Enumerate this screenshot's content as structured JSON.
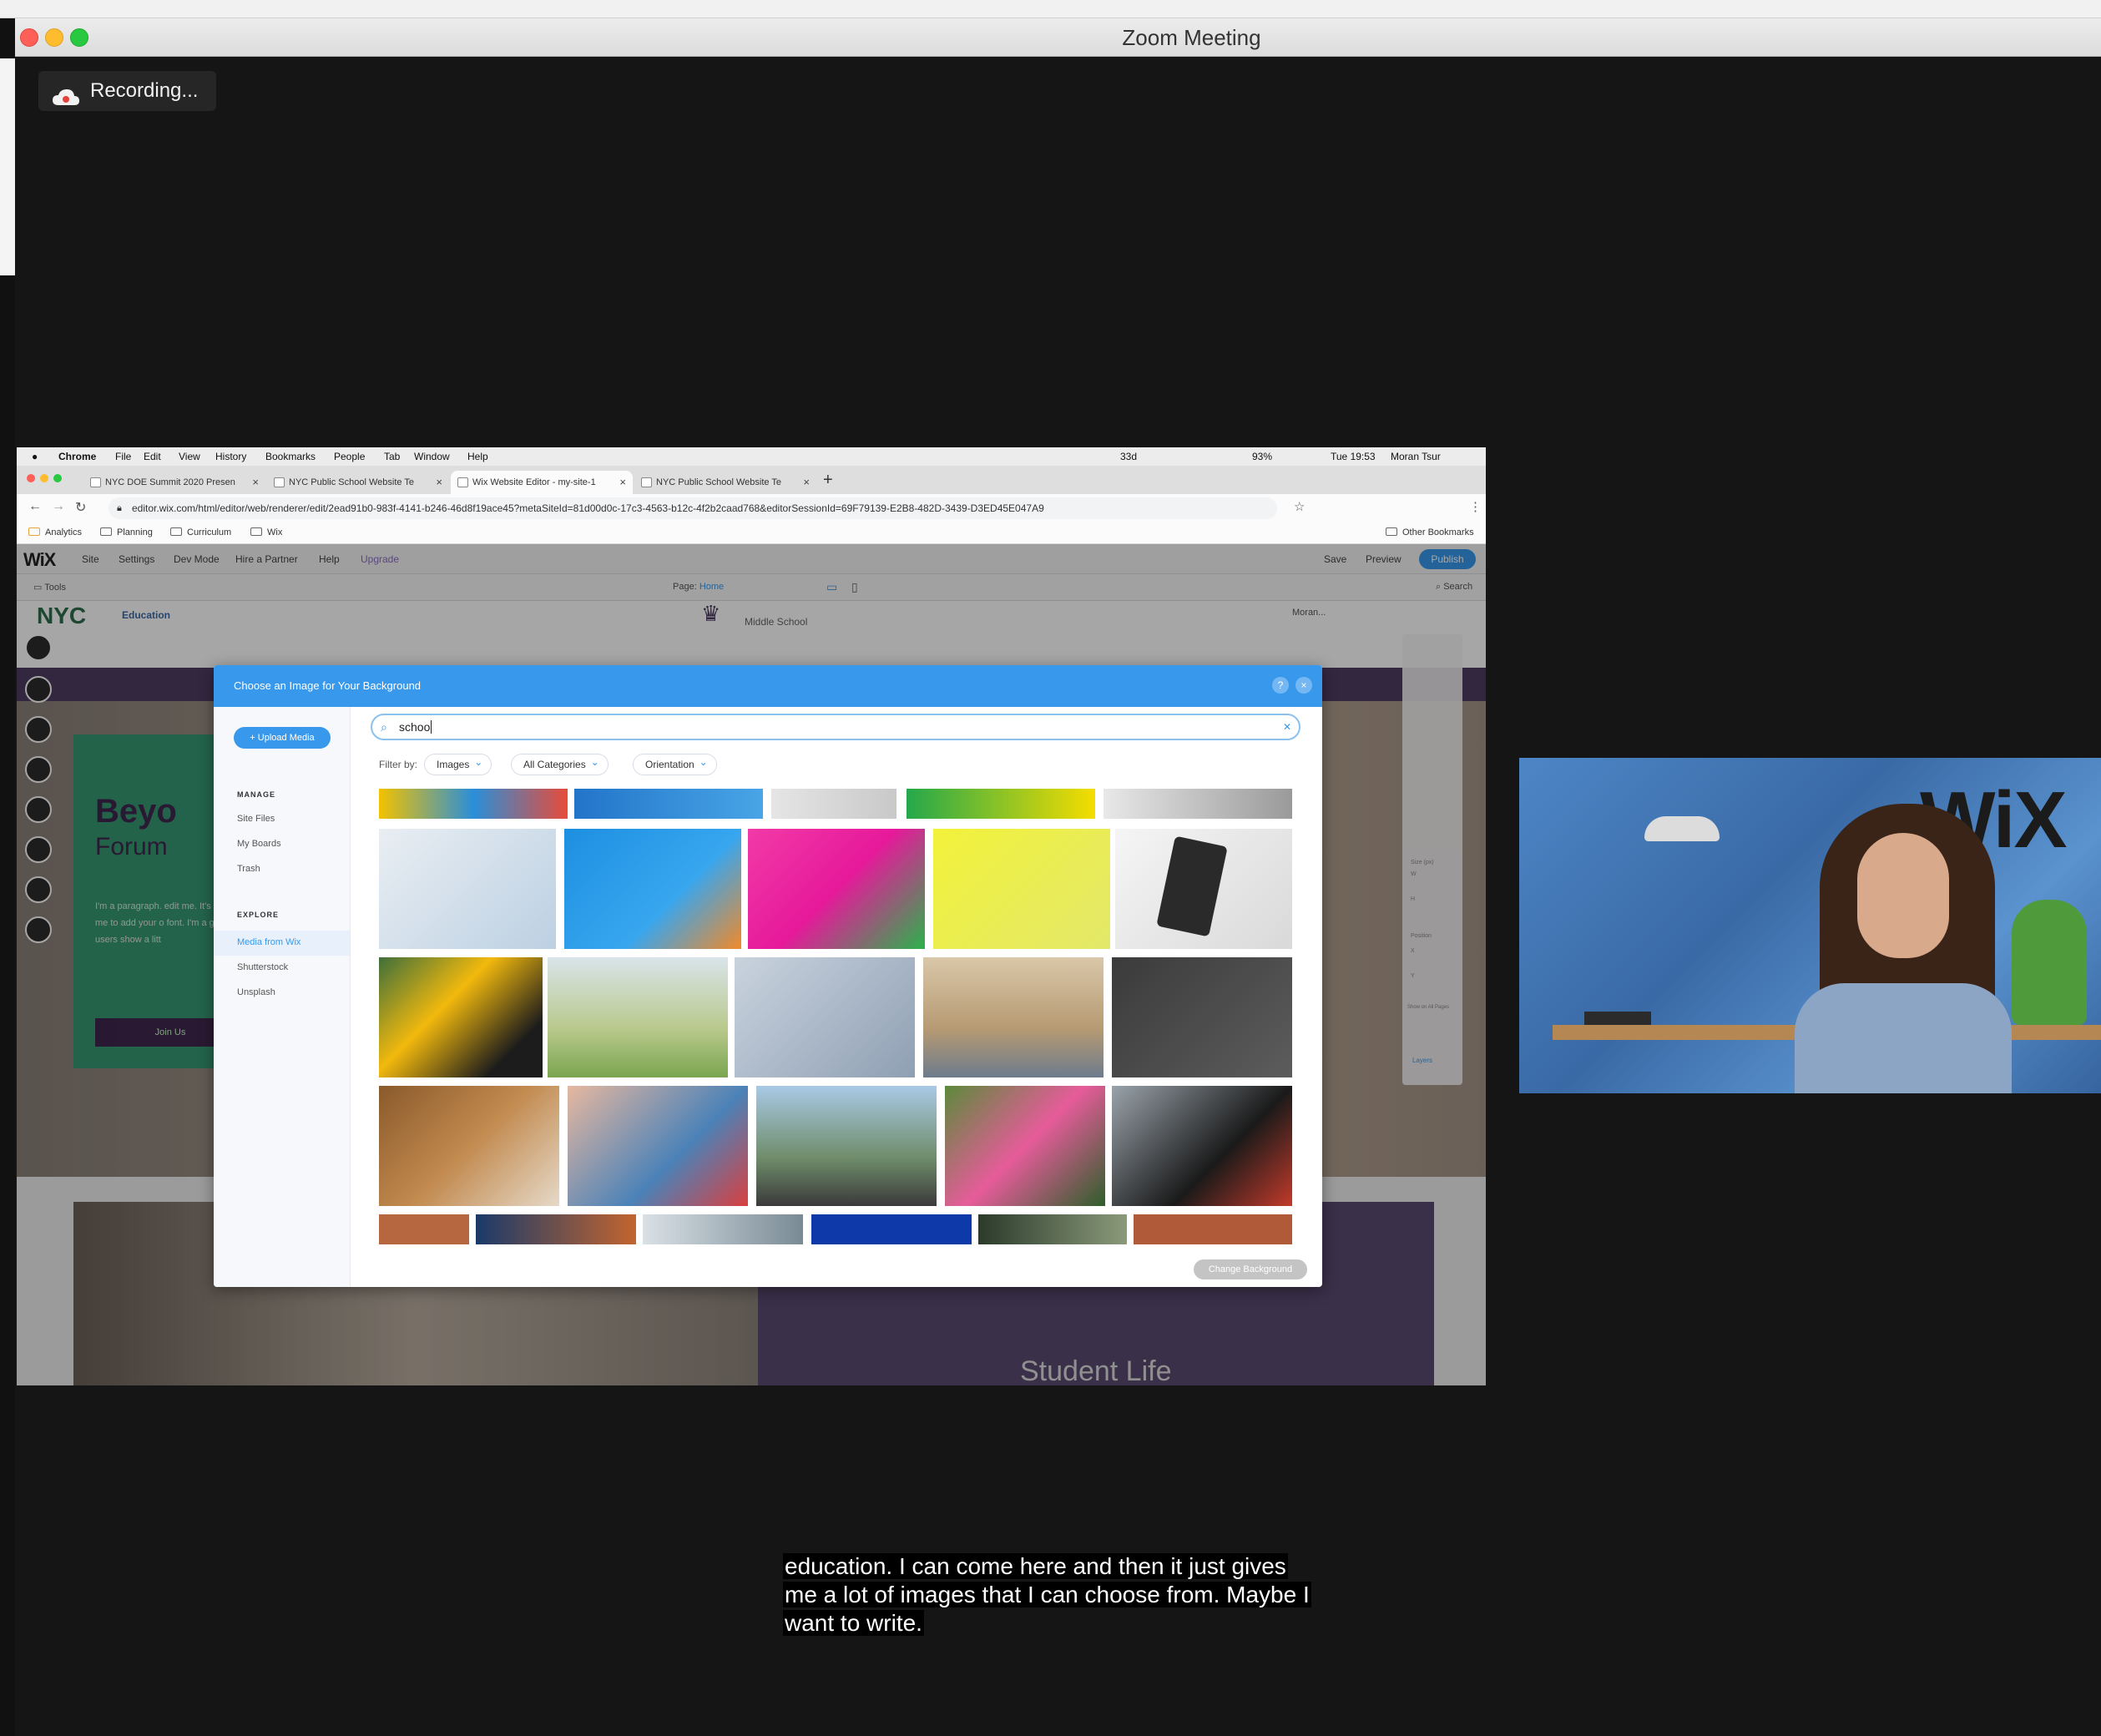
{
  "zoom": {
    "title": "Zoom Meeting",
    "recording_label": "Recording..."
  },
  "mac_menubar": {
    "apple": "",
    "items": [
      "Chrome",
      "File",
      "Edit",
      "View",
      "History",
      "Bookmarks",
      "People",
      "Tab",
      "Window",
      "Help"
    ],
    "status": {
      "battery_cycles": "33d",
      "battery": "93%",
      "clock": "Tue 19:53",
      "user": "Moran Tsur"
    }
  },
  "chrome": {
    "tabs": [
      {
        "label": "NYC DOE Summit 2020 Presen"
      },
      {
        "label": "NYC Public School Website Te"
      },
      {
        "label": "Wix Website Editor - my-site-1"
      },
      {
        "label": "NYC Public School Website Te"
      }
    ],
    "url": "editor.wix.com/html/editor/web/renderer/edit/2ead91b0-983f-4141-b246-46d8f19ace45?metaSiteId=81d00d0c-17c3-4563-b12c-4f2b2caad768&editorSessionId=69F79139-E2B8-482D-3439-D3ED45E047A9",
    "bookmarks": [
      "Analytics",
      "Planning",
      "Curriculum",
      "Wix"
    ],
    "other_bookmarks": "Other Bookmarks"
  },
  "wix": {
    "logo": "WiX",
    "menu": [
      "Site",
      "Settings",
      "Dev Mode",
      "Hire a Partner",
      "Help",
      "Upgrade"
    ],
    "save": "Save",
    "preview": "Preview",
    "publish": "Publish",
    "tools": "Tools",
    "page_label": "Page:",
    "page_value": "Home",
    "search": "Search",
    "site_header": {
      "logo_text": "Education",
      "school": "Middle School",
      "member": "Moran..."
    },
    "hero": {
      "title": "Beyo",
      "subtitle": "Forum",
      "body": "I'm a paragraph. edit me. It's easy. me to add your o font. I'm a great users show a litt",
      "join": "Join Us"
    },
    "lower": {
      "heading": "Student Life"
    }
  },
  "dialog": {
    "title": "Choose an Image for Your Background",
    "help": "?",
    "close": "×",
    "upload": "+ Upload Media",
    "manage_heading": "MANAGE",
    "manage_items": [
      "Site Files",
      "My Boards",
      "Trash"
    ],
    "explore_heading": "EXPLORE",
    "explore_items": [
      "Media from Wix",
      "Shutterstock",
      "Unsplash"
    ],
    "search_value": "schoo",
    "filter_label": "Filter by:",
    "filters": [
      "Images",
      "All Categories",
      "Orientation"
    ],
    "change_button": "Change Background"
  },
  "right_panel": {
    "size": "Size (px)",
    "w": "W",
    "h": "H",
    "position": "Position",
    "x": "X",
    "y": "Y",
    "show": "Show on All Pages",
    "layers": "Layers"
  },
  "webcam": {
    "sign": "WiX"
  },
  "captions": {
    "lines": [
      "education. I can come here and then it just gives",
      "me a lot of images that I can choose from. Maybe I",
      "want to write."
    ]
  },
  "colors": {
    "wix_blue": "#3899ec",
    "zoom_bg": "#151515",
    "purple": "#4f3c63",
    "green": "#2f9a72"
  }
}
